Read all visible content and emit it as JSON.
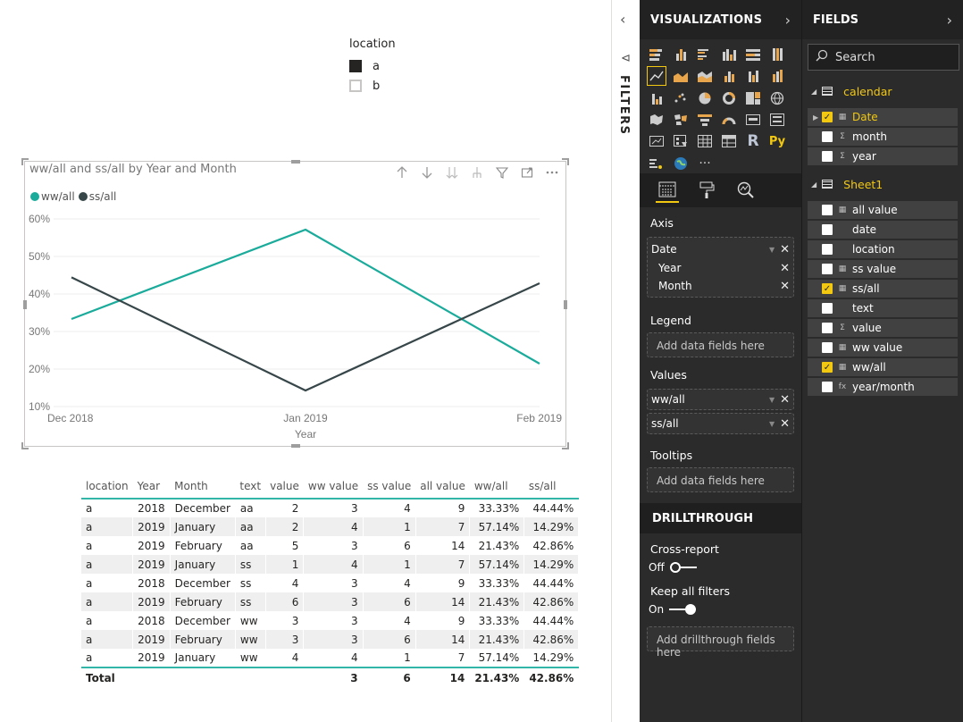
{
  "slicer": {
    "title": "location",
    "items": [
      {
        "label": "a",
        "checked": true
      },
      {
        "label": "b",
        "checked": false
      }
    ]
  },
  "chart": {
    "title": "ww/all and ss/all by Year and Month",
    "legend": [
      {
        "name": "ww/all",
        "color": "#1aab9b"
      },
      {
        "name": "ss/all",
        "color": "#374649"
      }
    ],
    "toolbar": [
      "drill-up-icon",
      "drill-down-icon",
      "expand-all-icon",
      "expand-hierarchy-icon",
      "filter-icon",
      "focus-mode-icon",
      "more-options-icon"
    ]
  },
  "chart_data": {
    "type": "line",
    "categories": [
      "Dec 2018",
      "Jan 2019",
      "Feb 2019"
    ],
    "series": [
      {
        "name": "ww/all",
        "values": [
          33.33,
          57.14,
          21.43
        ],
        "color": "#1aab9b"
      },
      {
        "name": "ss/all",
        "values": [
          44.44,
          14.29,
          42.86
        ],
        "color": "#374649"
      }
    ],
    "xlabel": "Year",
    "ylabel": "",
    "yticks": [
      "10%",
      "20%",
      "30%",
      "40%",
      "50%",
      "60%"
    ],
    "ylim": [
      10,
      60
    ],
    "grid": true,
    "legend_position": "top-left"
  },
  "table": {
    "columns": [
      "location",
      "Year",
      "Month",
      "text",
      "value",
      "ww value",
      "ss value",
      "all value",
      "ww/all",
      "ss/all"
    ],
    "rows": [
      [
        "a",
        "2018",
        "December",
        "aa",
        "2",
        "3",
        "4",
        "9",
        "33.33%",
        "44.44%"
      ],
      [
        "a",
        "2019",
        "January",
        "aa",
        "2",
        "4",
        "1",
        "7",
        "57.14%",
        "14.29%"
      ],
      [
        "a",
        "2019",
        "February",
        "aa",
        "5",
        "3",
        "6",
        "14",
        "21.43%",
        "42.86%"
      ],
      [
        "a",
        "2019",
        "January",
        "ss",
        "1",
        "4",
        "1",
        "7",
        "57.14%",
        "14.29%"
      ],
      [
        "a",
        "2018",
        "December",
        "ss",
        "4",
        "3",
        "4",
        "9",
        "33.33%",
        "44.44%"
      ],
      [
        "a",
        "2019",
        "February",
        "ss",
        "6",
        "3",
        "6",
        "14",
        "21.43%",
        "42.86%"
      ],
      [
        "a",
        "2018",
        "December",
        "ww",
        "3",
        "3",
        "4",
        "9",
        "33.33%",
        "44.44%"
      ],
      [
        "a",
        "2019",
        "February",
        "ww",
        "3",
        "3",
        "6",
        "14",
        "21.43%",
        "42.86%"
      ],
      [
        "a",
        "2019",
        "January",
        "ww",
        "4",
        "4",
        "1",
        "7",
        "57.14%",
        "14.29%"
      ]
    ],
    "total": [
      "Total",
      "",
      "",
      "",
      "",
      "3",
      "6",
      "14",
      "21.43%",
      "42.86%"
    ]
  },
  "filters": {
    "label": "FILTERS",
    "collapse_glyph": "‹",
    "filter_glyph": "⊲"
  },
  "visualizations": {
    "title": "VISUALIZATIONS",
    "chevron": "›",
    "axis_label": "Axis",
    "axis_field": "Date",
    "axis_subfields": [
      "Year",
      "Month"
    ],
    "legend_label": "Legend",
    "legend_placeholder": "Add data fields here",
    "values_label": "Values",
    "values_fields": [
      "ww/all",
      "ss/all"
    ],
    "tooltips_label": "Tooltips",
    "tooltips_placeholder": "Add data fields here",
    "drillthrough_title": "DRILLTHROUGH",
    "cross_report_label": "Cross-report",
    "cross_report_state": "Off",
    "keep_filters_label": "Keep all filters",
    "keep_filters_state": "On",
    "drillthrough_placeholder": "Add drillthrough fields here",
    "r_label": "R",
    "py_label": "Py",
    "more_label": "···"
  },
  "fields": {
    "title": "FIELDS",
    "chevron": "›",
    "search_placeholder": "Search",
    "tables": [
      {
        "name": "calendar",
        "fields": [
          {
            "name": "Date",
            "checked": true,
            "type": "hierarchy",
            "highlighted": true
          },
          {
            "name": "month",
            "checked": false,
            "type": "sigma"
          },
          {
            "name": "year",
            "checked": false,
            "type": "sigma"
          }
        ]
      },
      {
        "name": "Sheet1",
        "fields": [
          {
            "name": "all value",
            "checked": false,
            "type": "measure"
          },
          {
            "name": "date",
            "checked": false,
            "type": "none"
          },
          {
            "name": "location",
            "checked": false,
            "type": "none"
          },
          {
            "name": "ss value",
            "checked": false,
            "type": "measure"
          },
          {
            "name": "ss/all",
            "checked": true,
            "type": "measure"
          },
          {
            "name": "text",
            "checked": false,
            "type": "none"
          },
          {
            "name": "value",
            "checked": false,
            "type": "sigma"
          },
          {
            "name": "ww value",
            "checked": false,
            "type": "measure"
          },
          {
            "name": "ww/all",
            "checked": true,
            "type": "measure"
          },
          {
            "name": "year/month",
            "checked": false,
            "type": "calc"
          }
        ]
      }
    ]
  }
}
